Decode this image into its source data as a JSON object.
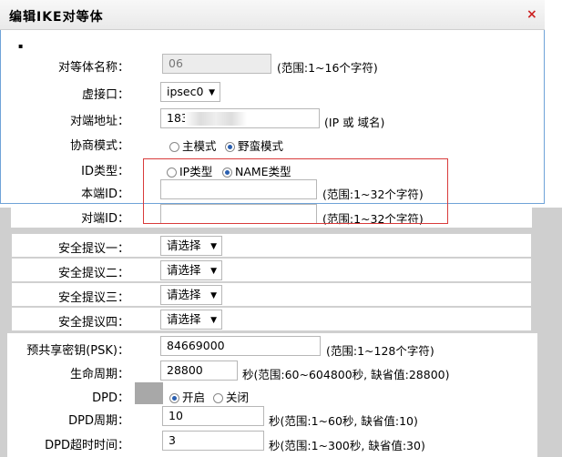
{
  "dialog": {
    "title": "编辑IKE对等体",
    "close_symbol": "×",
    "tick": "▪"
  },
  "form": {
    "peer_name": {
      "label": "对等体名称：",
      "value": "06",
      "hint": "(范围:1~16个字符)"
    },
    "virtual_if": {
      "label": "虚接口：",
      "value": "ipsec0"
    },
    "peer_addr": {
      "label": "对端地址：",
      "value": "183",
      "hint": "(IP 或 域名)"
    },
    "negotiation": {
      "label": "协商模式：",
      "options": [
        "主模式",
        "野蛮模式"
      ],
      "selected": "野蛮模式"
    },
    "id_type": {
      "label": "ID类型：",
      "options": [
        "IP类型",
        "NAME类型"
      ],
      "selected": "NAME类型"
    },
    "local_id": {
      "label": "本端ID：",
      "value": "",
      "hint": "(范围:1~32个字符)"
    },
    "remote_id": {
      "label": "对端ID：",
      "value": "",
      "hint": "(范围:1~32个字符)"
    }
  },
  "proposals": [
    {
      "label": "安全提议一：",
      "value": "请选择"
    },
    {
      "label": "安全提议二：",
      "value": "请选择"
    },
    {
      "label": "安全提议三：",
      "value": "请选择"
    },
    {
      "label": "安全提议四：",
      "value": "请选择"
    }
  ],
  "security": {
    "psk": {
      "label": "预共享密钥(PSK)：",
      "value": "84669000",
      "hint": "(范围:1~128个字符)"
    },
    "lifetime": {
      "label": "生命周期：",
      "value": "28800",
      "hint": "秒(范围:60~604800秒, 缺省值:28800)"
    },
    "dpd": {
      "label": "DPD：",
      "options": [
        "开启",
        "关闭"
      ],
      "selected": "开启"
    },
    "dpd_period": {
      "label": "DPD周期：",
      "value": "10",
      "hint": "秒(范围:1~60秒, 缺省值:10)"
    },
    "dpd_timeout": {
      "label": "DPD超时时间：",
      "value": "3",
      "hint": "秒(范围:1~300秒, 缺省值:30)"
    }
  },
  "colors": {
    "highlight_border": "#d93b3b",
    "dialog_border": "#6fa3d8",
    "radio_dot": "#2a5fb0"
  }
}
